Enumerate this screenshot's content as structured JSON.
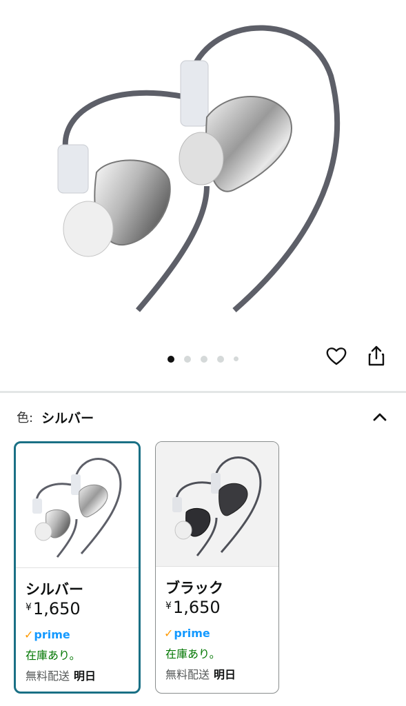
{
  "hero": {
    "icon": "earphones-product-image"
  },
  "carousel": {
    "dot_count": 5,
    "active_index": 0
  },
  "actions": {
    "wishlist_icon": "heart-icon",
    "share_icon": "share-icon"
  },
  "color": {
    "label": "色:",
    "value": "シルバー",
    "collapse_icon": "chevron-up-icon"
  },
  "variants": [
    {
      "name": "シルバー",
      "currency": "¥",
      "price": "1,650",
      "prime": "prime",
      "stock": "在庫あり。",
      "shipping": "無料配送",
      "delivery": "明日",
      "selected": true
    },
    {
      "name": "ブラック",
      "currency": "¥",
      "price": "1,650",
      "prime": "prime",
      "stock": "在庫あり。",
      "shipping": "無料配送",
      "delivery": "明日",
      "selected": false
    }
  ],
  "colors": {
    "selected_border": "#1a7085",
    "stock_green": "#007600",
    "prime_blue": "#1399ff",
    "prime_check": "#ff9900"
  }
}
